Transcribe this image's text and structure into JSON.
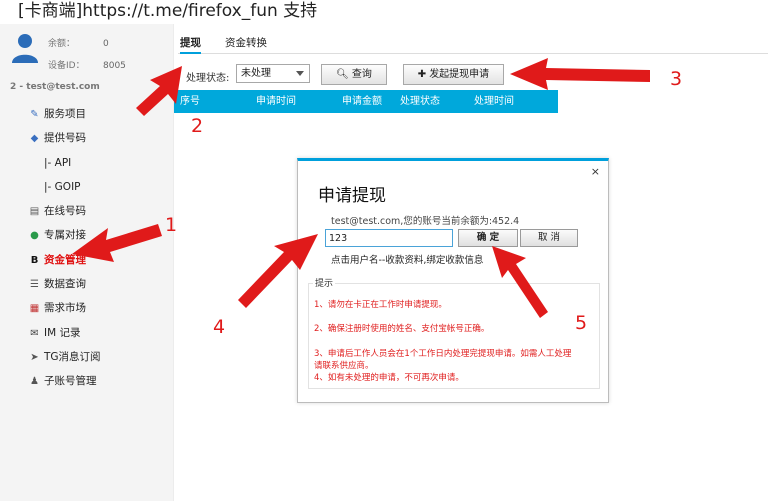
{
  "header": {
    "title": "[卡商端]https://t.me/firefox_fun 支持"
  },
  "account": {
    "balance_label": "余额：",
    "balance_value": "0",
    "device_label": "设备ID：",
    "device_value": "8005",
    "user_line": "2 - test@test.com"
  },
  "sidebar": {
    "items": [
      {
        "label": "服务项目",
        "icon": "wrench-icon"
      },
      {
        "label": "提供号码",
        "icon": "diamond-icon"
      },
      {
        "label": "|-  API",
        "icon": ""
      },
      {
        "label": "|-  GOIP",
        "icon": ""
      },
      {
        "label": "在线号码",
        "icon": "list-box-icon"
      },
      {
        "label": "专属对接",
        "icon": "link-icon"
      },
      {
        "label": "资金管理",
        "icon": "b-icon",
        "active": true
      },
      {
        "label": "数据查询",
        "icon": "list-icon"
      },
      {
        "label": "需求市场",
        "icon": "chart-icon"
      },
      {
        "label": "IM 记录",
        "icon": "mail-icon"
      },
      {
        "label": "TG消息订阅",
        "icon": "telegram-icon"
      },
      {
        "label": "子账号管理",
        "icon": "users-icon"
      }
    ]
  },
  "tabs": [
    {
      "label": "提现",
      "active": true
    },
    {
      "label": "资金转换",
      "active": false
    }
  ],
  "toolbar": {
    "filter_label": "处理状态:",
    "status_selected": "未处理",
    "query_label": "查询",
    "apply_label": "发起提现申请"
  },
  "grid": {
    "columns": [
      "序号",
      "申请时间",
      "申请金额",
      "处理状态",
      "处理时间"
    ]
  },
  "dialog": {
    "title": "申请提现",
    "close": "×",
    "balance_text": "test@test.com,您的账号当前余额为:452.4",
    "amount_value": "123",
    "confirm_label": "确 定",
    "cancel_label": "取 消",
    "bind_text": "点击用户名--收款资料,绑定收款信息",
    "tips_title": "提示",
    "tips": [
      "1、请勿在卡正在工作时申请提现。",
      "2、确保注册时使用的姓名、支付宝帐号正确。",
      "3、申请后工作人员会在1个工作日内处理完提现申请。如需人工处理",
      "请联系供应商。",
      "4、如有未处理的申请，不可再次申请。"
    ]
  },
  "annotations": {
    "color": "#e01a1a",
    "labels": [
      "1",
      "2",
      "3",
      "4",
      "5"
    ]
  }
}
